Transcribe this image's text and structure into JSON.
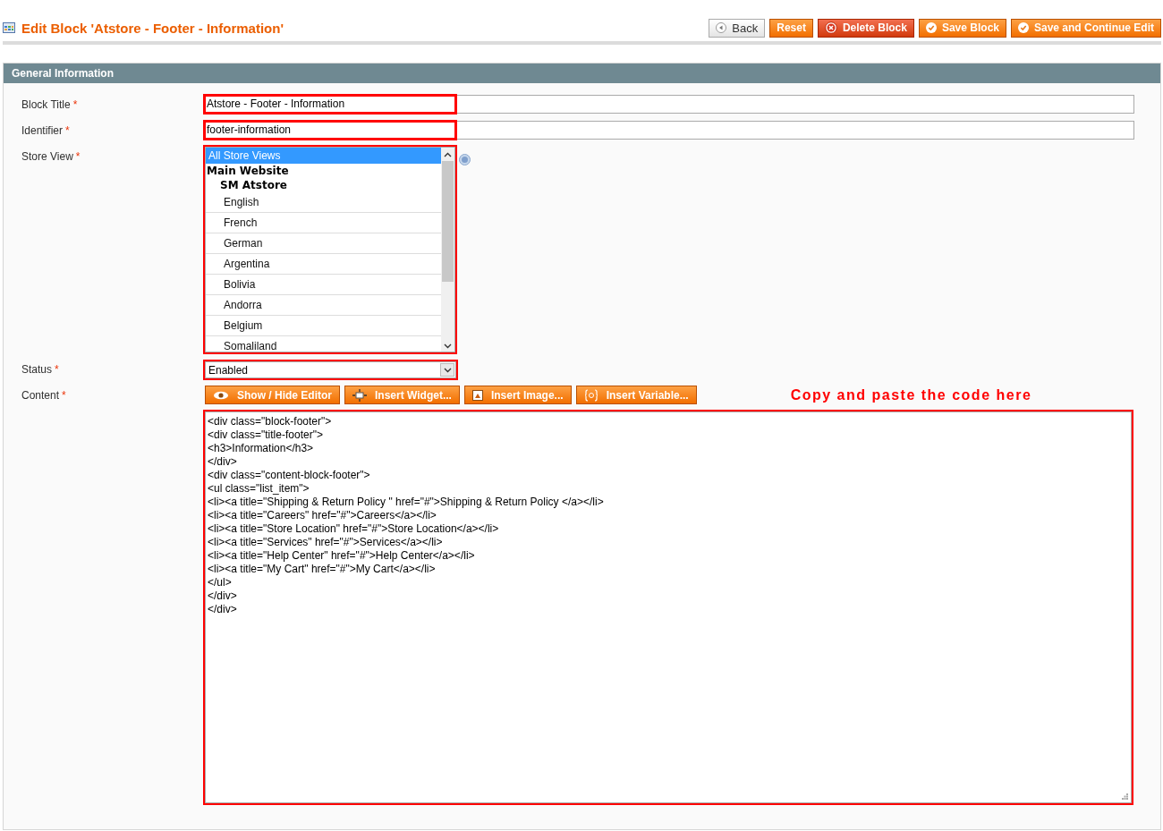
{
  "page_title": "Edit Block 'Atstore - Footer - Information'",
  "actions": [
    {
      "label": "Back",
      "kind": "back"
    },
    {
      "label": "Reset",
      "kind": "plain"
    },
    {
      "label": "Delete Block",
      "kind": "delete"
    },
    {
      "label": "Save Block",
      "kind": "save"
    },
    {
      "label": "Save and Continue Edit",
      "kind": "save"
    }
  ],
  "section": {
    "title": "General Information"
  },
  "fields": [
    {
      "label": "Block Title",
      "required_mark": "*",
      "value": "Atstore - Footer - Information",
      "highlighted": true
    },
    {
      "label": "Identifier",
      "required_mark": "*",
      "value": "footer-information",
      "highlighted": true
    }
  ],
  "store_view": {
    "label": "Store View",
    "required_mark": "*",
    "highlighted": true,
    "options": [
      {
        "label": "All Store Views",
        "selected": true
      }
    ],
    "groups": [
      {
        "label": "Main Website",
        "children": [
          {
            "label": "SM Atstore",
            "children": [
              {
                "label": "English",
                "selected": false
              },
              {
                "label": "French",
                "selected": false
              },
              {
                "label": "German",
                "selected": false
              },
              {
                "label": "Argentina",
                "selected": false
              },
              {
                "label": "Bolivia",
                "selected": false
              },
              {
                "label": "Andorra",
                "selected": false
              },
              {
                "label": "Belgium",
                "selected": false
              },
              {
                "label": "Somaliland",
                "selected": false
              }
            ]
          }
        ]
      }
    ]
  },
  "status": {
    "label": "Status",
    "required_mark": "*",
    "value": "Enabled",
    "highlighted": true
  },
  "content": {
    "label": "Content",
    "required_mark": "*",
    "highlighted": true,
    "editor_buttons": [
      {
        "label": "Show / Hide Editor",
        "kind": "eye"
      },
      {
        "label": "Insert Widget...",
        "kind": "widget"
      },
      {
        "label": "Insert Image...",
        "kind": "image"
      },
      {
        "label": "Insert Variable...",
        "kind": "variable"
      }
    ],
    "annotation": "Copy and paste the code here",
    "lines": [
      "<div class=\"block-footer\">",
      "<div class=\"title-footer\">",
      "<h3>Information</h3>",
      "</div>",
      "<div class=\"content-block-footer\">",
      "<ul class=\"list_item\">",
      "<li><a title=\"Shipping & Return Policy \" href=\"#\">Shipping & Return Policy </a></li>",
      "<li><a title=\"Careers\" href=\"#\">Careers</a></li>",
      "<li><a title=\"Store Location\" href=\"#\">Store Location</a></li>",
      "<li><a title=\"Services\" href=\"#\">Services</a></li>",
      "<li><a title=\"Help Center\" href=\"#\">Help Center</a></li>",
      "<li><a title=\"My Cart\" href=\"#\">My Cart</a></li>",
      "</ul>",
      "</div>",
      "</div>"
    ]
  }
}
